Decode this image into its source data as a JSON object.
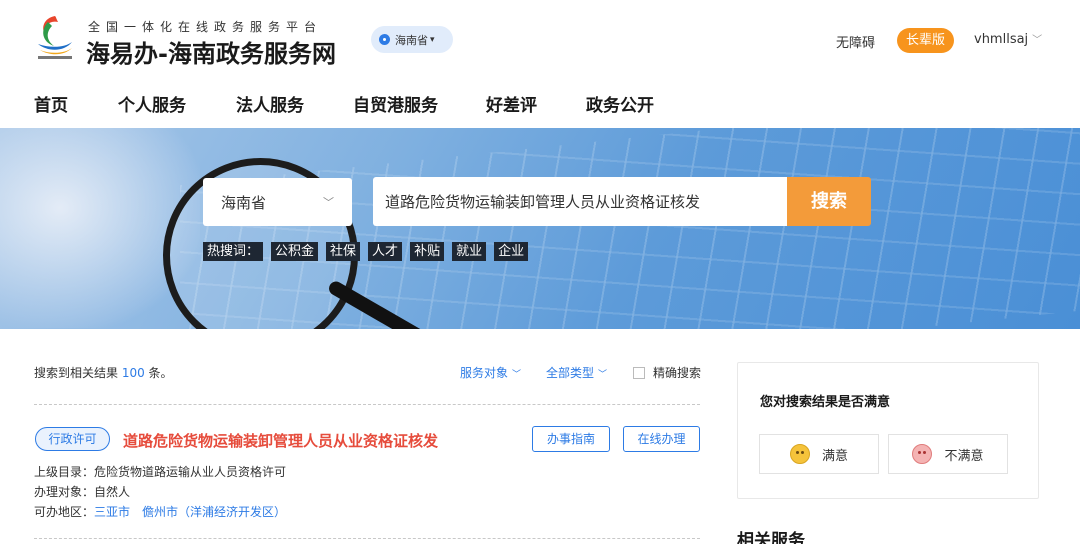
{
  "header": {
    "tagline": "全国一体化在线政务服务平台",
    "title": "海易办-海南政务服务网",
    "region": "海南省",
    "accessibility": "无障碍",
    "elder_mode": "长辈版",
    "username": "vhmllsaj"
  },
  "nav": {
    "items": [
      "首页",
      "个人服务",
      "法人服务",
      "自贸港服务",
      "好差评",
      "政务公开"
    ]
  },
  "search": {
    "region": "海南省",
    "query": "道路危险货物运输装卸管理人员从业资格证核发",
    "button": "搜索",
    "hot_label": "热搜词：",
    "hot_words": [
      "公积金",
      "社保",
      "人才",
      "补贴",
      "就业",
      "企业"
    ]
  },
  "results": {
    "summary_prefix": "搜索到相关结果 ",
    "count": "100",
    "summary_suffix": " 条。",
    "filter_audience": "服务对象",
    "filter_type": "全部类型",
    "exact_search": "精确搜索",
    "items": [
      {
        "tag": "行政许可",
        "title": "道路危险货物运输装卸管理人员从业资格证核发",
        "guide_button": "办事指南",
        "online_button": "在线办理",
        "parent_label": "上级目录：",
        "parent_value": "危险货物道路运输从业人员资格许可",
        "target_label": "办理对象：",
        "target_value": "自然人",
        "area_label": "可办地区：",
        "areas": [
          "三亚市",
          "儋州市（洋浦经济开发区）"
        ]
      }
    ]
  },
  "sidebar": {
    "satisfaction_question": "您对搜索结果是否满意",
    "satisfied": "满意",
    "unsatisfied": "不满意",
    "related_title": "相关服务"
  },
  "colors": {
    "accent_blue": "#2d7be5",
    "orange": "#f39b3a",
    "title_red": "#e64c3c"
  }
}
